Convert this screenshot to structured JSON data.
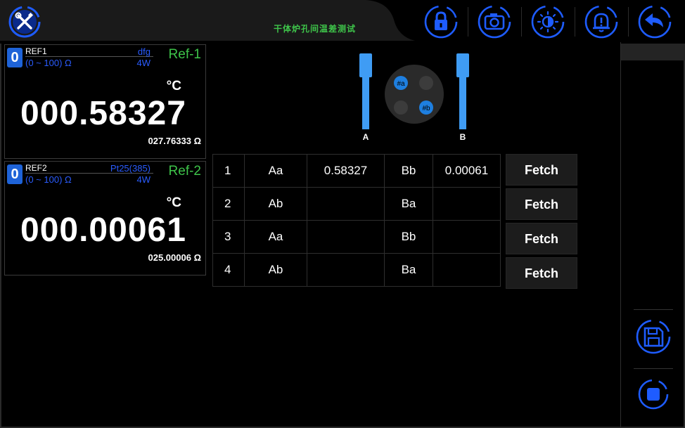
{
  "header": {
    "title": "干体炉孔间温差测试",
    "buttons": [
      {
        "icon": "tools-icon"
      },
      {
        "icon": "lock-icon"
      },
      {
        "icon": "camera-icon"
      },
      {
        "icon": "brightness-icon"
      },
      {
        "icon": "alarm-icon"
      },
      {
        "icon": "back-icon"
      }
    ]
  },
  "references": [
    {
      "index": "0",
      "name": "REF1",
      "sensor": "dfg",
      "range": "(0 ~ 100) Ω",
      "wire": "4W",
      "tag": "Ref-1",
      "unit": "°C",
      "value": "000.58327",
      "resistance": "027.76333 Ω"
    },
    {
      "index": "0",
      "name": "REF2",
      "sensor": "Pt25(385)",
      "range": "(0 ~ 100) Ω",
      "wire": "4W",
      "tag": "Ref-2",
      "unit": "°C",
      "value": "000.00061",
      "resistance": "025.00006 Ω"
    }
  ],
  "diagram": {
    "probe_a": "A",
    "probe_b": "B",
    "hole_a": "#a",
    "hole_b": "#b"
  },
  "table": {
    "rows": [
      {
        "idx": "1",
        "p1": "Aa",
        "v1": "0.58327",
        "p2": "Bb",
        "v2": "0.00061"
      },
      {
        "idx": "2",
        "p1": "Ab",
        "v1": "",
        "p2": "Ba",
        "v2": ""
      },
      {
        "idx": "3",
        "p1": "Aa",
        "v1": "",
        "p2": "Bb",
        "v2": ""
      },
      {
        "idx": "4",
        "p1": "Ab",
        "v1": "",
        "p2": "Ba",
        "v2": ""
      }
    ],
    "fetch_label": "Fetch"
  },
  "sidebar": {
    "buttons": [
      {
        "icon": "save-icon"
      },
      {
        "icon": "stop-icon"
      }
    ]
  },
  "colors": {
    "accent_blue": "#1e5cff",
    "title_green": "#3ec44a",
    "index_blue": "#1e63d8"
  }
}
